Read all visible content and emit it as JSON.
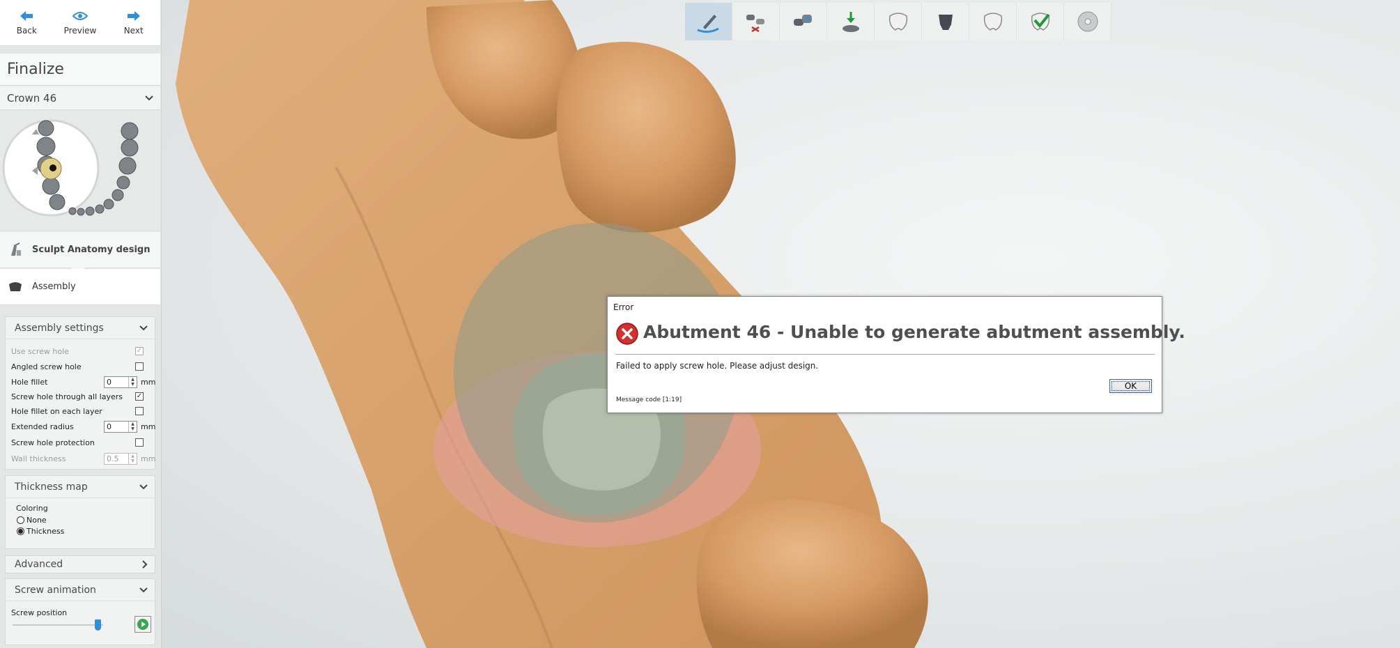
{
  "nav": {
    "back": "Back",
    "preview": "Preview",
    "next": "Next"
  },
  "step_title": "Finalize",
  "crown_select": "Crown 46",
  "workflow": {
    "sculpt": "Sculpt Anatomy design",
    "assembly": "Assembly"
  },
  "assembly_settings": {
    "header": "Assembly settings",
    "use_screw_hole": "Use screw hole",
    "angled_screw_hole": "Angled screw hole",
    "hole_fillet": "Hole fillet",
    "hole_fillet_value": "0",
    "screw_hole_through": "Screw hole through all layers",
    "hole_fillet_each": "Hole fillet on each  layer",
    "extended_radius": "Extended radius",
    "extended_radius_value": "0",
    "screw_hole_protection": "Screw hole protection",
    "wall_thickness": "Wall thickness",
    "wall_thickness_value": "0.5",
    "unit": "mm"
  },
  "thickness_map": {
    "header": "Thickness map",
    "coloring": "Coloring",
    "none": "None",
    "thickness": "Thickness"
  },
  "advanced": {
    "header": "Advanced"
  },
  "screw_animation": {
    "header": "Screw animation",
    "screw_position": "Screw position",
    "slider_position": 0.94
  },
  "dialog": {
    "title": "Error",
    "headline": "Abutment 46 - Unable to generate abutment assembly.",
    "body": "Failed to apply screw hole. Please adjust design.",
    "code": "Message code [1:19]",
    "ok": "OK"
  },
  "colors": {
    "accent": "#2f8fd8",
    "model": "#d9a46e",
    "error": "#d32f2f"
  }
}
